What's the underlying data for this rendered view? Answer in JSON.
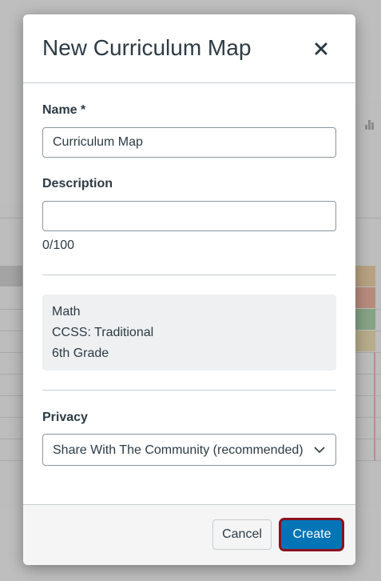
{
  "modal": {
    "title": "New Curriculum Map",
    "close_icon": "close-icon"
  },
  "name_field": {
    "label": "Name *",
    "value": "Curriculum Map"
  },
  "description_field": {
    "label": "Description",
    "value": "",
    "char_count": "0/100"
  },
  "context": {
    "lines": [
      "Math",
      "CCSS: Traditional",
      "6th Grade"
    ]
  },
  "privacy": {
    "label": "Privacy",
    "selected": "Share With The Community (recommended)",
    "chevron_icon": "chevron-down-icon"
  },
  "footer": {
    "cancel_label": "Cancel",
    "create_label": "Create"
  },
  "colors": {
    "primary": "#0374b5",
    "highlight": "#8b1220",
    "text": "#2d3b45"
  }
}
